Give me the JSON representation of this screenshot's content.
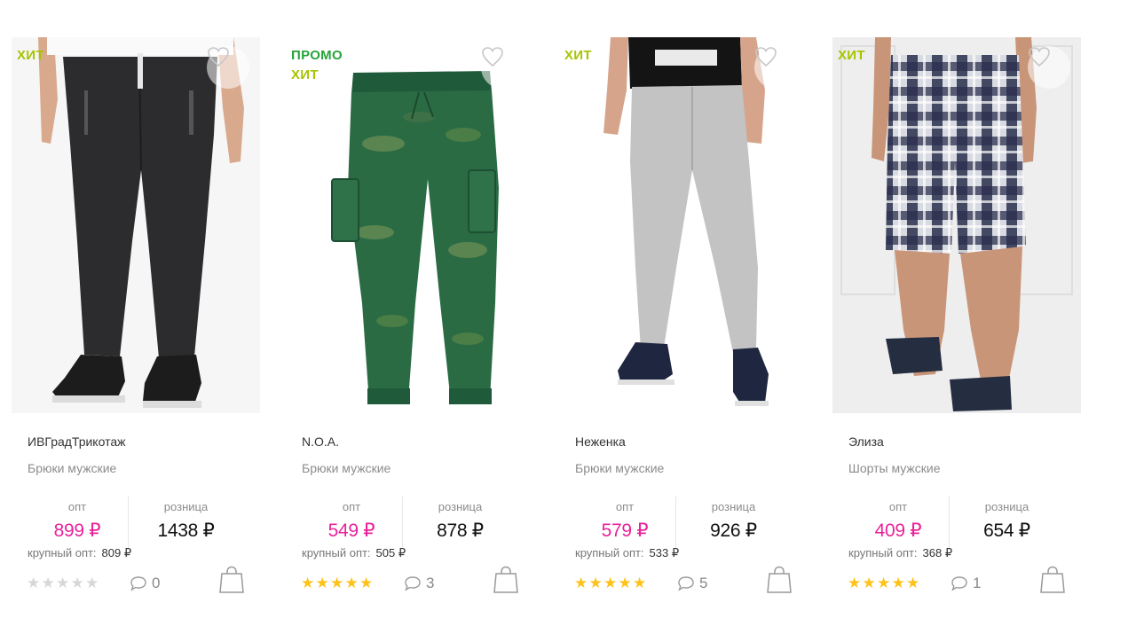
{
  "currency": "₽",
  "labels": {
    "wholesale": "опт",
    "retail": "розница",
    "bulk": "крупный опт:"
  },
  "colors": {
    "hit_badge": "#a8c400",
    "promo_badge": "#26a33a",
    "wholesale_price": "#e9219a",
    "star_filled": "#ffc21a",
    "star_empty": "#d7d7d7"
  },
  "products": [
    {
      "badges": [
        "ХИТ"
      ],
      "brand": "ИВГрадТрикотаж",
      "type": "Брюки мужские",
      "wholesale_price": "899 ₽",
      "retail_price": "1438 ₽",
      "bulk_price": "809 ₽",
      "rating": 0,
      "comments": "0",
      "image": "dark gray jogger pants on model with black sneakers"
    },
    {
      "badges": [
        "ПРОМО",
        "ХИТ"
      ],
      "brand": "N.O.A.",
      "type": "Брюки мужские",
      "wholesale_price": "549 ₽",
      "retail_price": "878 ₽",
      "bulk_price": "505 ₽",
      "rating": 5,
      "comments": "3",
      "image": "green camouflage cargo pants flat lay"
    },
    {
      "badges": [
        "ХИТ"
      ],
      "brand": "Неженка",
      "type": "Брюки мужские",
      "wholesale_price": "579 ₽",
      "retail_price": "926 ₽",
      "bulk_price": "533 ₽",
      "rating": 5,
      "comments": "5",
      "image": "light gray sweatpants on model with black t-shirt"
    },
    {
      "badges": [
        "ХИТ"
      ],
      "brand": "Элиза",
      "type": "Шорты мужские",
      "wholesale_price": "409 ₽",
      "retail_price": "654 ₽",
      "bulk_price": "368 ₽",
      "rating": 5,
      "comments": "1",
      "image": "navy plaid shorts on model with slide sandals"
    }
  ]
}
